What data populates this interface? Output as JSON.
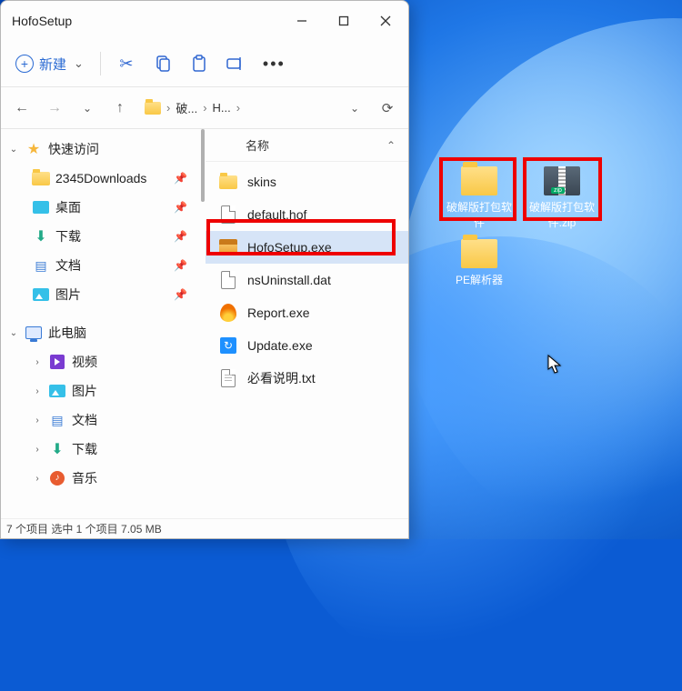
{
  "window": {
    "title": "HofoSetup",
    "new_label": "新建",
    "chevdown": "⌄"
  },
  "nav": {
    "back": "←",
    "forward": "→",
    "up": "↑",
    "crumb1": "破...",
    "crumb2": "H...",
    "sep": "›"
  },
  "sidebar": {
    "quick": "快速访问",
    "items": [
      {
        "label": "2345Downloads"
      },
      {
        "label": "桌面"
      },
      {
        "label": "下载"
      },
      {
        "label": "文档"
      },
      {
        "label": "图片"
      }
    ],
    "pc": "此电脑",
    "pc_items": [
      {
        "label": "视频"
      },
      {
        "label": "图片"
      },
      {
        "label": "文档"
      },
      {
        "label": "下载"
      },
      {
        "label": "音乐"
      }
    ]
  },
  "content": {
    "col_name": "名称",
    "files": [
      {
        "name": "skins",
        "kind": "folder"
      },
      {
        "name": "default.hof",
        "kind": "doc"
      },
      {
        "name": "HofoSetup.exe",
        "kind": "box",
        "selected": true
      },
      {
        "name": "nsUninstall.dat",
        "kind": "doc"
      },
      {
        "name": "Report.exe",
        "kind": "fire"
      },
      {
        "name": "Update.exe",
        "kind": "upd"
      },
      {
        "name": "必看说明.txt",
        "kind": "txt"
      }
    ]
  },
  "status": "7 个项目    选中 1 个项目  7.05 MB",
  "desktop": {
    "icons": [
      {
        "label": "破解版打包软件",
        "kind": "folder"
      },
      {
        "label": "破解版打包软件.zip",
        "kind": "zip"
      },
      {
        "label": "PE解析器",
        "kind": "folder"
      }
    ]
  }
}
